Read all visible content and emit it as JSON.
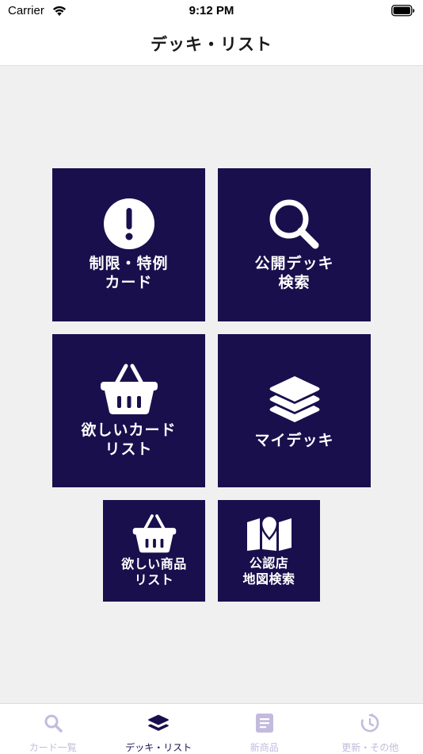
{
  "status_bar": {
    "carrier": "Carrier",
    "time": "9:12 PM"
  },
  "nav": {
    "title": "デッキ・リスト"
  },
  "tiles": {
    "restricted_cards": {
      "label": "制限・特例\nカード",
      "icon": "exclamation-icon"
    },
    "public_deck_search": {
      "label": "公開デッキ\n検索",
      "icon": "search-icon"
    },
    "wanted_cards": {
      "label": "欲しいカード\nリスト",
      "icon": "basket-icon"
    },
    "my_deck": {
      "label": "マイデッキ",
      "icon": "layers-icon"
    },
    "wanted_products": {
      "label": "欲しい商品\nリスト",
      "icon": "basket-icon"
    },
    "official_store_map": {
      "label": "公認店\n地図検索",
      "icon": "map-icon"
    }
  },
  "tab_bar": {
    "tabs": [
      {
        "label": "カード一覧",
        "icon": "search-icon",
        "active": false
      },
      {
        "label": "デッキ・リスト",
        "icon": "layers-icon",
        "active": true
      },
      {
        "label": "新商品",
        "icon": "document-icon",
        "active": false
      },
      {
        "label": "更新・その他",
        "icon": "history-icon",
        "active": false
      }
    ]
  },
  "colors": {
    "tile_background": "#1a0f4d",
    "tab_active": "#1a0f4d",
    "tab_inactive": "#c3bbdd",
    "content_background": "#f0f0f0"
  }
}
